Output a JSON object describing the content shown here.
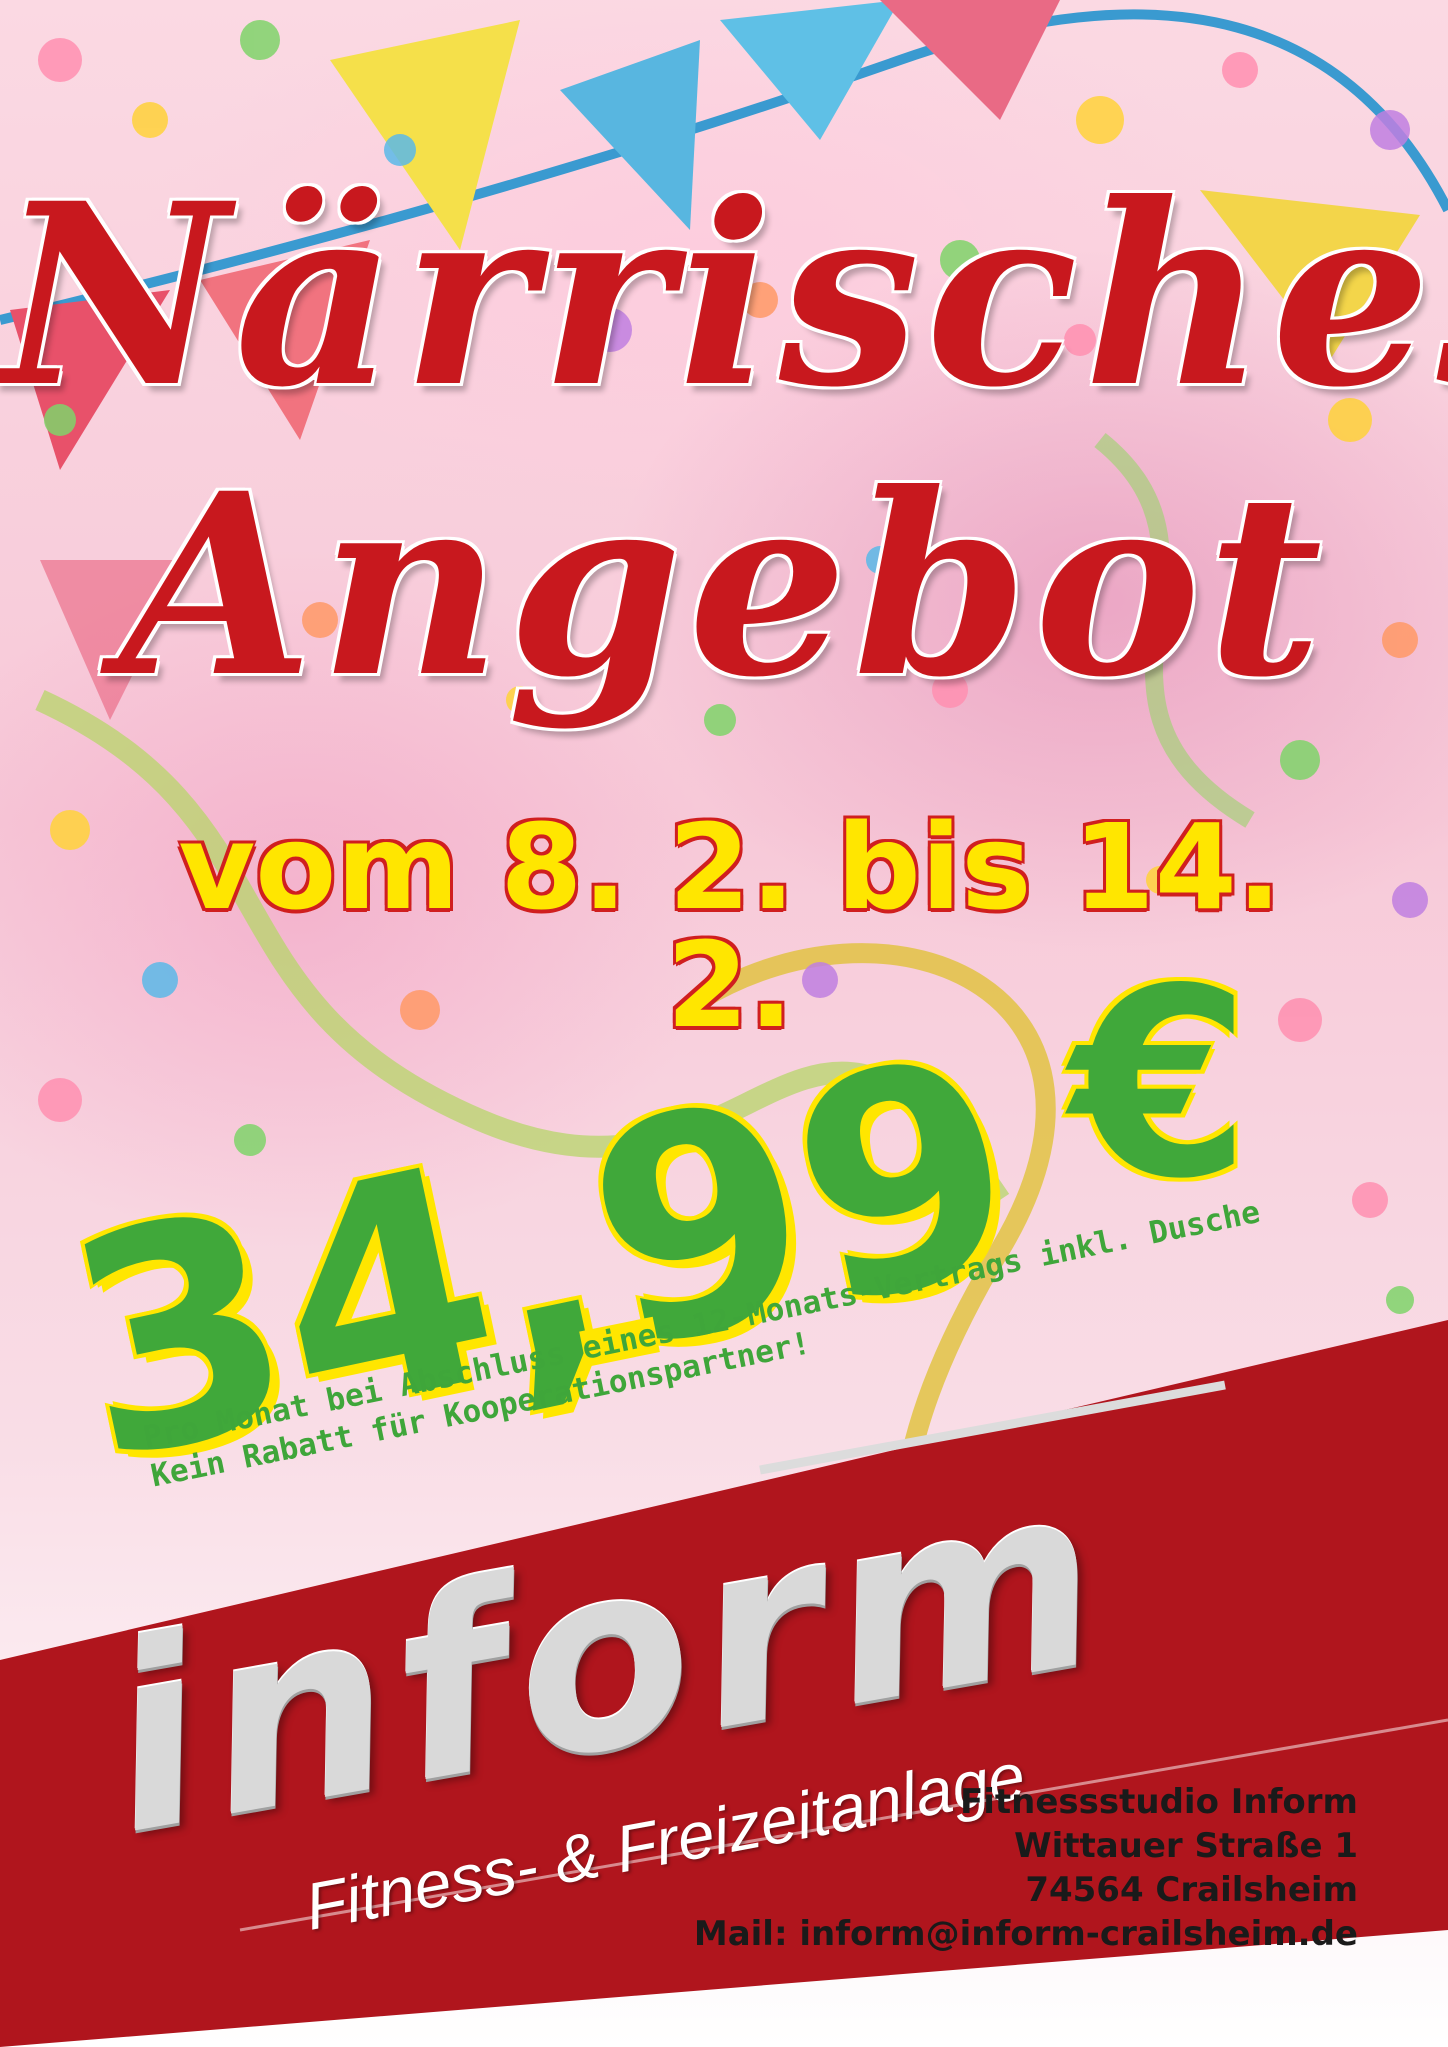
{
  "poster": {
    "title_line1": "Närrisches",
    "title_line2": "Angebot",
    "dates": "vom 8. 2. bis 14. 2.",
    "price": "34,99",
    "currency": "€",
    "terms": {
      "line1_part1": "Pro Monat bei Abschluss ",
      "line1_highlight": "eine",
      "line1_part2": "s 12-Monats-Vertrags inkl. Dusche",
      "line2": "Kein Rabatt für Kooperationspartner!"
    },
    "brand": "inform",
    "tagline": "Fitness- & Freizeitanlage",
    "contact": {
      "name": "Fitnessstudio Inform",
      "street": "Wittauer Straße 1",
      "city": "74564 Crailsheim",
      "mail": "Mail: inform@inform-crailsheim.de"
    }
  },
  "colors": {
    "title_red": "#c8181e",
    "date_yellow": "#ffe600",
    "price_green": "#40a83a",
    "banner_red": "#b0151d"
  },
  "icons": [
    "bunting-flags",
    "confetti",
    "streamer"
  ]
}
